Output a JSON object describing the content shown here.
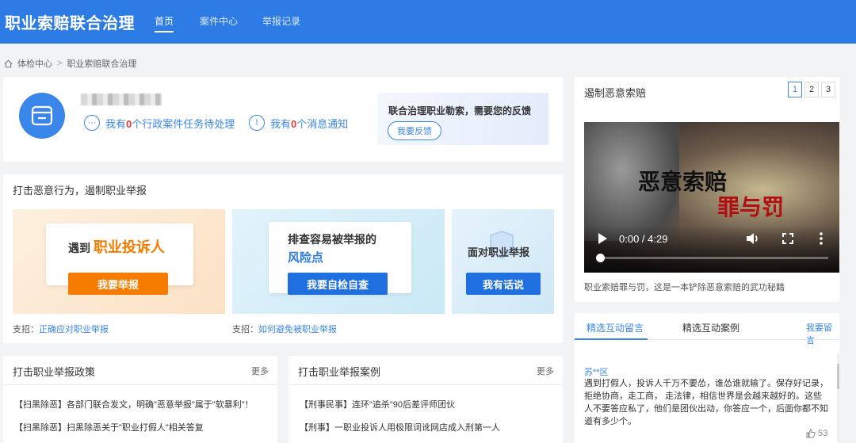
{
  "header": {
    "brand": "职业索赔联合治理",
    "nav": [
      "首页",
      "案件中心",
      "举报记录"
    ]
  },
  "breadcrumb": [
    "体检中心",
    "职业索赔联合治理"
  ],
  "profile": {
    "stat1": {
      "prefix": "我有",
      "count": "0",
      "suffix": "个行政案件任务待处理"
    },
    "stat2": {
      "prefix": "我有",
      "count": "0",
      "suffix": "个消息通知"
    },
    "feedback_title": "联合治理职业勒索，需要您的反馈",
    "feedback_button": "我要反馈"
  },
  "report": {
    "title": "打击恶意行为，遏制职业举报",
    "banner1": {
      "lead": "遇到",
      "highlight": "职业投诉人",
      "button": "我要举报"
    },
    "banner2": {
      "line1": "排查容易被举报的",
      "line2": "风险点",
      "button": "我要自检自查"
    },
    "banner3": {
      "line1": "面对职业举报",
      "button": "我有话说"
    },
    "tip1": {
      "label": "支招：",
      "link": "正确应对职业举报"
    },
    "tip2": {
      "label": "支招：",
      "link": "如何避免被职业举报"
    }
  },
  "policy": {
    "title": "打击职业举报政策",
    "more": "更多",
    "items": [
      "【扫黑除恶】各部门联合发文，明确\"恶意举报\"属于\"软暴利\"！",
      "【扫黑除恶】扫黑除恶关于\"职业打假人\"相关答复"
    ]
  },
  "cases": {
    "title": "打击职业举报案例",
    "more": "更多",
    "items": [
      "【刑事民事】连环\"追杀\"90后差评师团伙",
      "【刑事】一职业投诉人用极限词讹网店成入刑第一人"
    ]
  },
  "video_panel": {
    "title": "遏制恶意索赔",
    "pages": [
      "1",
      "2",
      "3"
    ],
    "video_title_1": "恶意索赔",
    "video_title_2": "罪与罚",
    "time": "0:00 / 4:29",
    "caption": "职业索赔罪与罚，这是一本铲除恶意索赔的武功秘籍"
  },
  "comments": {
    "tabs": [
      "精选互动留言",
      "精选互动案例"
    ],
    "action": "我要留言",
    "user": "苏**区",
    "text": "遇到打假人，投诉人千万不要怂，谁怂谁就输了。保存好记录，拒绝协商，走工商， 走法律，相信世界是会越来越好的。这些人不要答应私了，他们是团伙出动，你答应一个，后面你都不知道有多少个。",
    "likes": "53"
  },
  "colors": {
    "primary": "#2d7be5",
    "accent": "#3a86ea",
    "orange": "#f57c00",
    "red": "#e53935"
  }
}
